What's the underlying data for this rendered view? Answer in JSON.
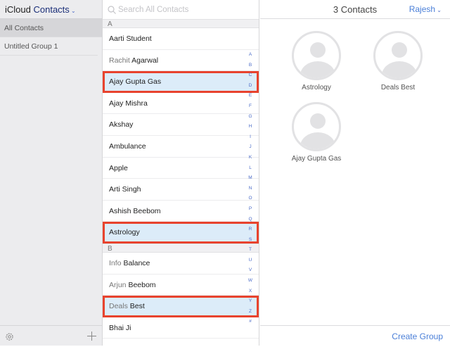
{
  "sidebar": {
    "title_a": "iCloud",
    "title_b": "Contacts",
    "groups": [
      "All Contacts",
      "Untitled Group 1"
    ]
  },
  "search": {
    "placeholder": "Search All Contacts"
  },
  "list": {
    "sections": [
      {
        "letter": "A",
        "rows": [
          {
            "first": "",
            "last": "Aarti Student",
            "selected": false
          },
          {
            "first": "Rachit",
            "last": "Agarwal",
            "selected": false
          },
          {
            "first": "",
            "last": "Ajay Gupta Gas",
            "selected": true
          },
          {
            "first": "",
            "last": "Ajay Mishra",
            "selected": false
          },
          {
            "first": "",
            "last": "Akshay",
            "selected": false
          },
          {
            "first": "",
            "last": "Ambulance",
            "selected": false
          },
          {
            "first": "",
            "last": "Apple",
            "selected": false
          },
          {
            "first": "",
            "last": "Arti Singh",
            "selected": false
          },
          {
            "first": "",
            "last": "Ashish Beebom",
            "selected": false
          },
          {
            "first": "",
            "last": "Astrology",
            "selected": true
          }
        ]
      },
      {
        "letter": "B",
        "rows": [
          {
            "first": "Info",
            "last": "Balance",
            "selected": false
          },
          {
            "first": "Arjun",
            "last": "Beebom",
            "selected": false
          },
          {
            "first": "Deals",
            "last": "Best",
            "selected": true
          },
          {
            "first": "",
            "last": "Bhai Ji",
            "selected": false
          }
        ]
      }
    ],
    "index": [
      "A",
      "B",
      "C",
      "D",
      "E",
      "F",
      "G",
      "H",
      "I",
      "J",
      "K",
      "L",
      "M",
      "N",
      "O",
      "P",
      "Q",
      "R",
      "S",
      "T",
      "U",
      "V",
      "W",
      "X",
      "Y",
      "Z",
      "#"
    ]
  },
  "detail": {
    "count": "3 Contacts",
    "user": "Rajesh",
    "cards": [
      "Astrology",
      "Deals Best",
      "Ajay Gupta Gas"
    ],
    "create_group": "Create Group"
  },
  "colors": {
    "accent": "#4a7fd8",
    "highlight": "#e8432e",
    "selected_bg": "#dcecf9"
  }
}
